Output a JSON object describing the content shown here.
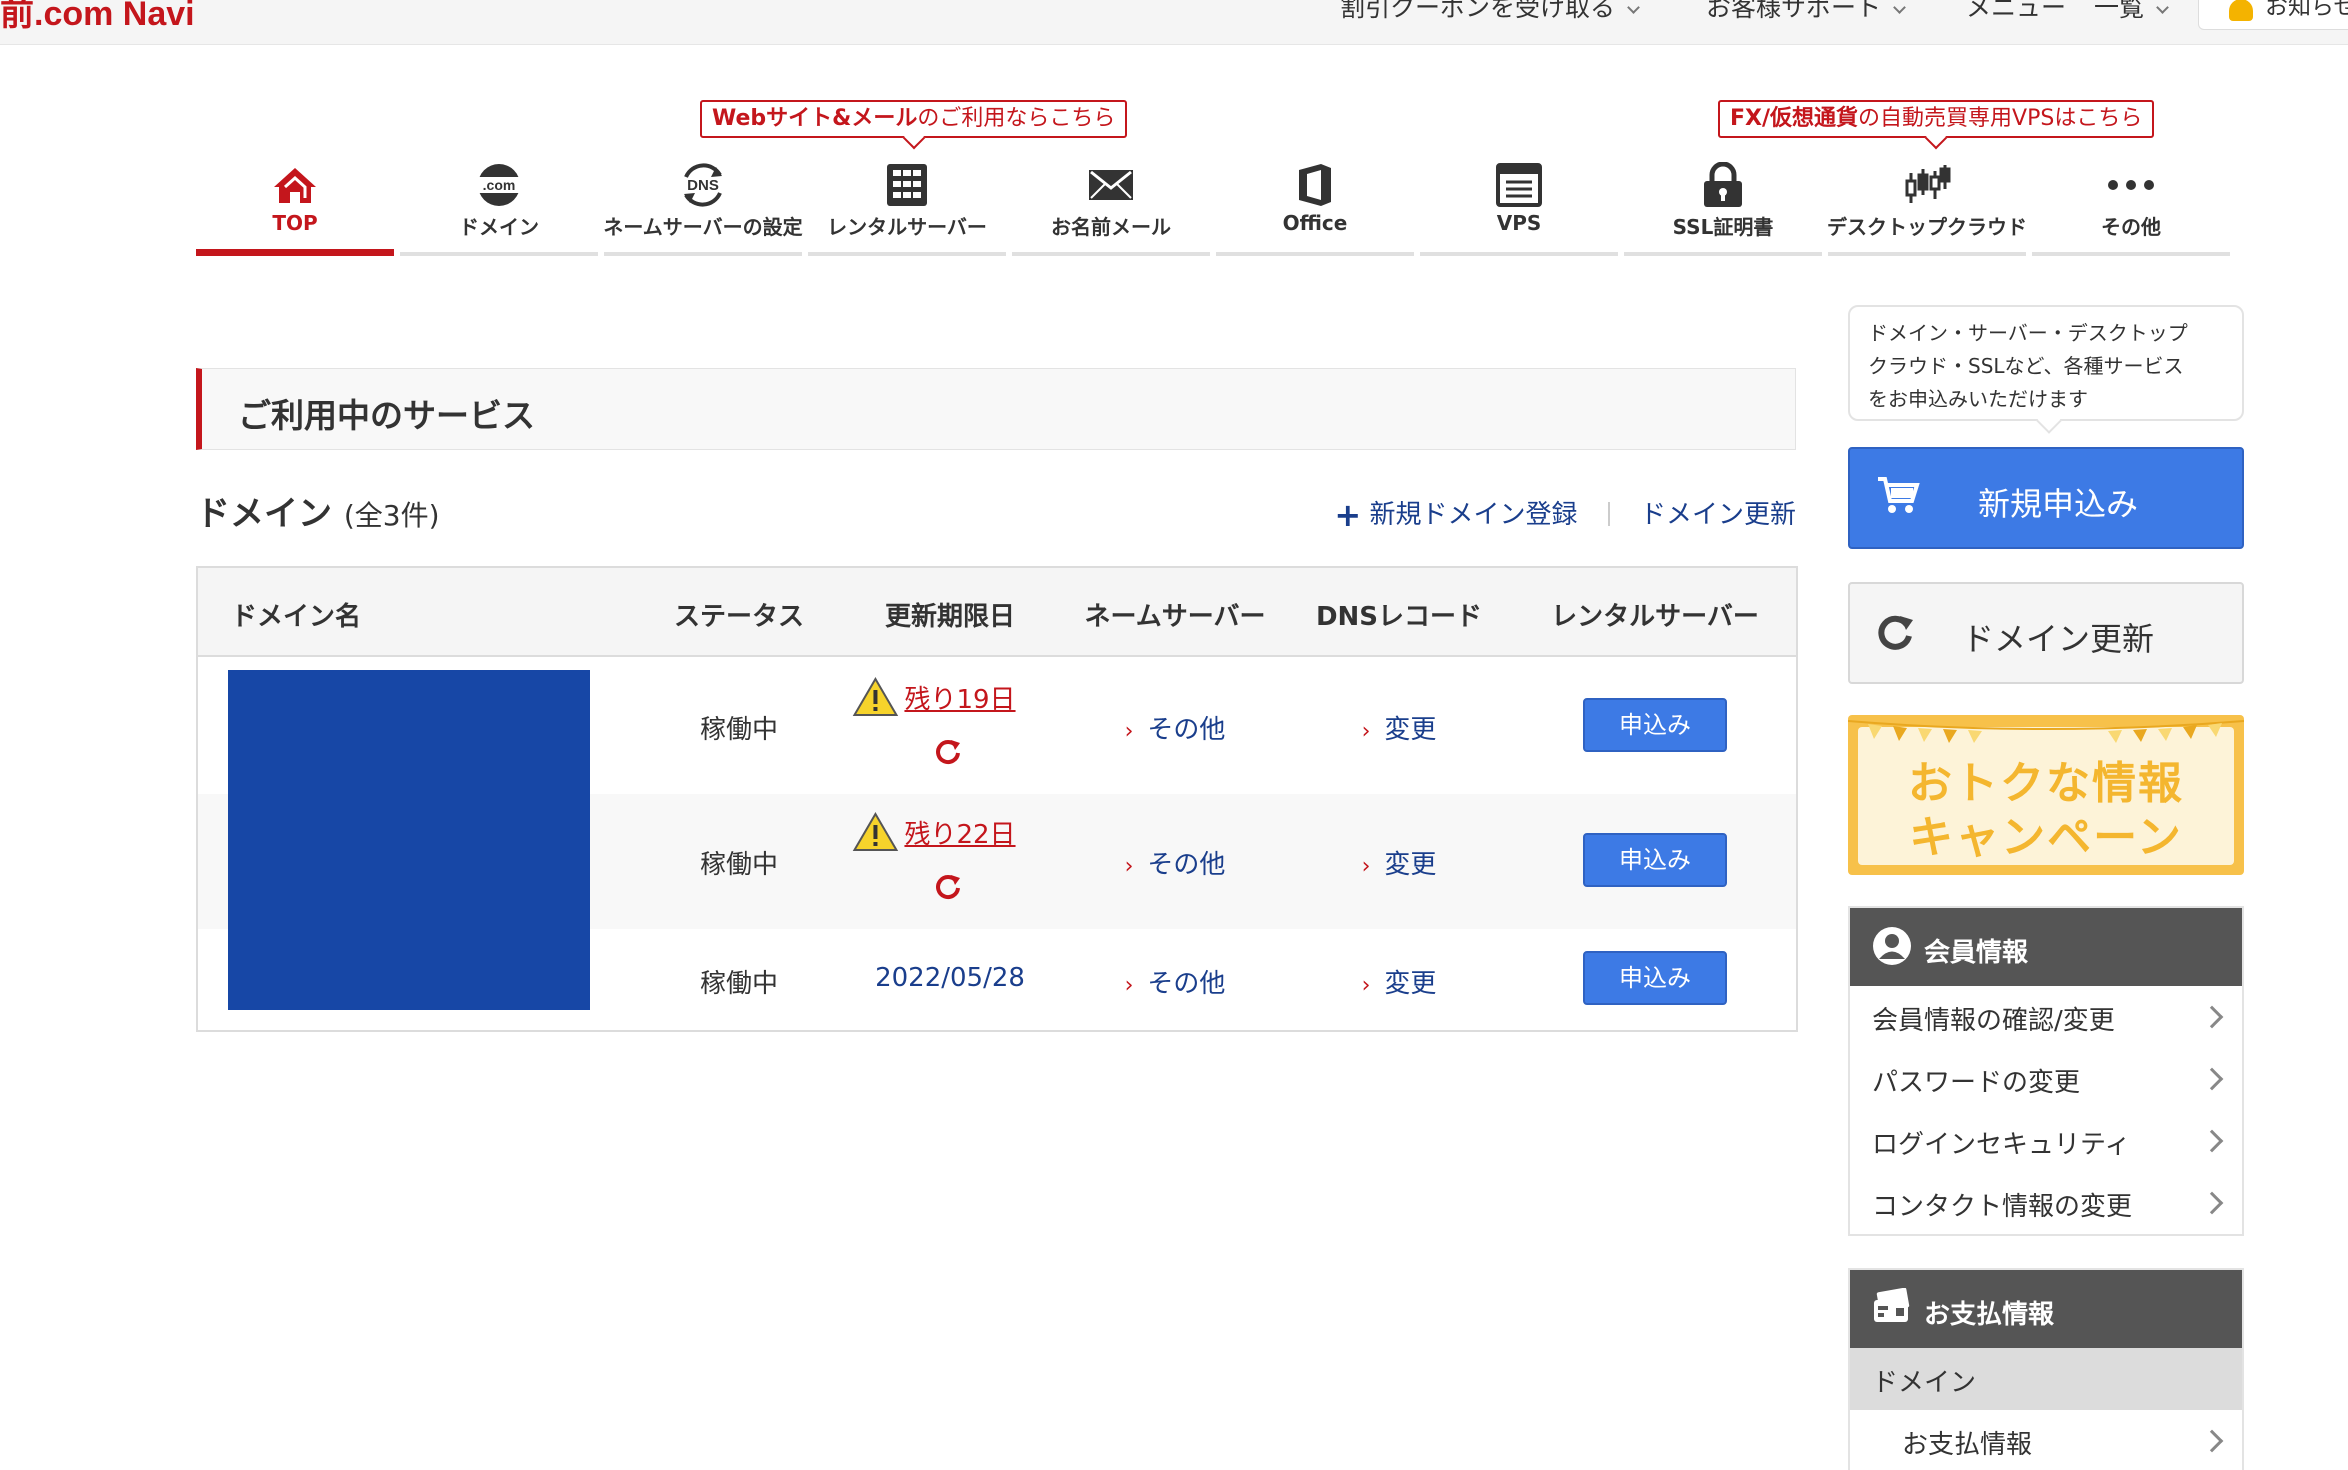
{
  "topbar": {
    "logo": "前.com Navi",
    "menu": [
      "割引クーポンを受け取る",
      "お客様サポート",
      "メニュー",
      "一覧"
    ],
    "notice": "お知らせ"
  },
  "nav": {
    "items": [
      {
        "label": "TOP",
        "icon": "home-icon"
      },
      {
        "label": "ドメイン",
        "icon": "dotcom-icon"
      },
      {
        "label": "ネームサーバーの設定",
        "icon": "dns-icon"
      },
      {
        "label": "レンタルサーバー",
        "icon": "server-icon"
      },
      {
        "label": "お名前メール",
        "icon": "mail-icon"
      },
      {
        "label": "Office",
        "icon": "office-icon"
      },
      {
        "label": "VPS",
        "icon": "vps-icon"
      },
      {
        "label": "SSL証明書",
        "icon": "lock-icon"
      },
      {
        "label": "デスクトップクラウド",
        "icon": "chart-icon"
      },
      {
        "label": "その他",
        "icon": "more-icon"
      }
    ],
    "promo1_bold": "Webサイト&メール",
    "promo1_rest": "のご利用ならこちら",
    "promo2_bold": "FX/仮想通貨",
    "promo2_rest": "の自動売買専用VPSはこちら"
  },
  "main": {
    "section_title": "ご利用中のサービス",
    "domain_title": "ドメイン",
    "domain_count": "(全3件)",
    "new_domain_link": "新規ドメイン登録",
    "renew_link": "ドメイン更新",
    "columns": [
      "ドメイン名",
      "ステータス",
      "更新期限日",
      "ネームサーバー",
      "DNSレコード",
      "レンタルサーバー"
    ],
    "rows": [
      {
        "status": "稼働中",
        "expire": "残り19日",
        "nameserver": "その他",
        "dns": "変更",
        "server": "申込み"
      },
      {
        "status": "稼働中",
        "expire": "残り22日",
        "nameserver": "その他",
        "dns": "変更",
        "server": "申込み"
      },
      {
        "status": "稼働中",
        "expire": "2022/05/28",
        "nameserver": "その他",
        "dns": "変更",
        "server": "申込み"
      }
    ]
  },
  "sidebar": {
    "bubble": [
      "ドメイン・サーバー・デスクトップ",
      "クラウド・SSLなど、各種サービス",
      "をお申込みいただけます"
    ],
    "apply": "新規申込み",
    "renew": "ドメイン更新",
    "campaign_line1": "おトクな情報",
    "campaign_line2": "キャンペーン",
    "member_title": "会員情報",
    "member_items": [
      "会員情報の確認/変更",
      "パスワードの変更",
      "ログインセキュリティ",
      "コンタクト情報の変更"
    ],
    "payment_title": "お支払情報",
    "payment_category": "ドメイン",
    "payment_item": "お支払情報"
  },
  "colors": {
    "brand": "#c4161c",
    "button": "#3d7ae5",
    "link": "#1a3e8c",
    "redacted": "#1747a6"
  }
}
